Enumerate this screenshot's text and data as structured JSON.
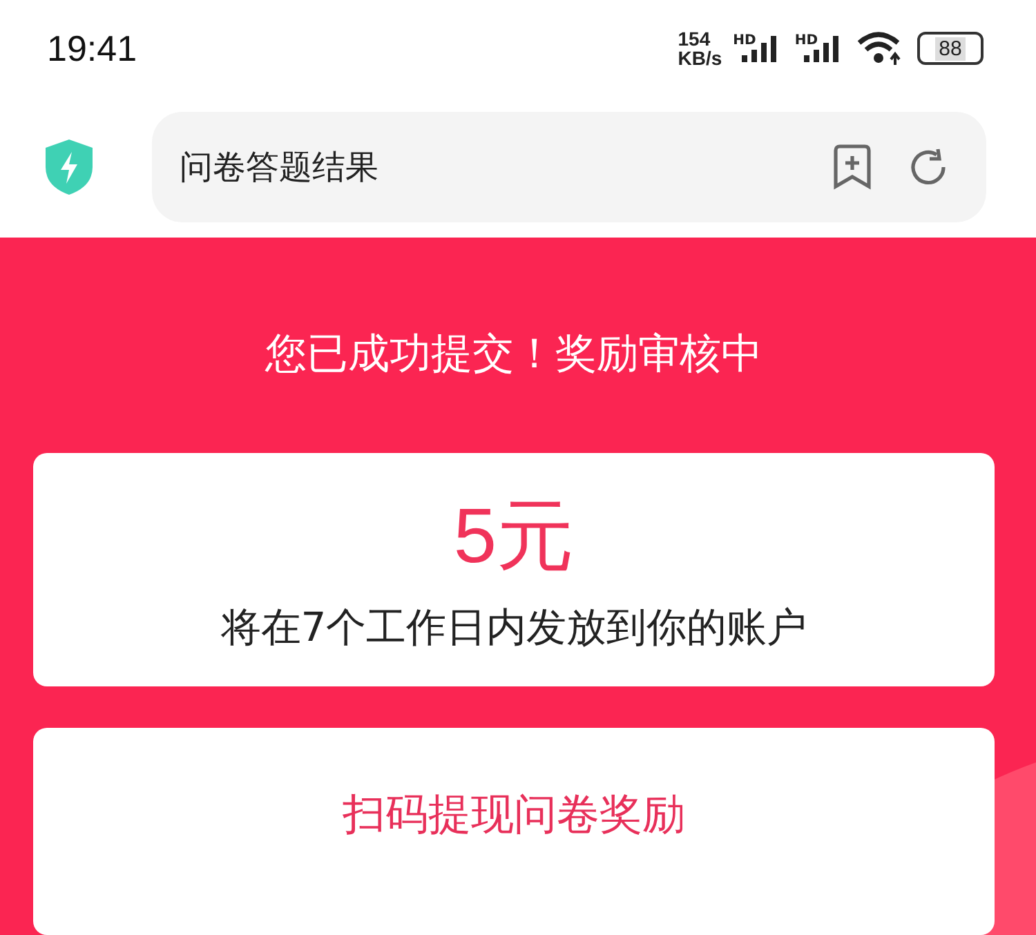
{
  "status_bar": {
    "time": "19:41",
    "speed_value": "154",
    "speed_unit": "KB/s",
    "network_labels": [
      "HD",
      "HD"
    ],
    "battery": "88"
  },
  "address_bar": {
    "title": "问卷答题结果"
  },
  "result": {
    "heading": "您已成功提交！奖励审核中",
    "amount": "5元",
    "note": "将在7个工作日内发放到你的账户"
  },
  "withdraw_card": {
    "title": "扫码提现问卷奖励"
  }
}
